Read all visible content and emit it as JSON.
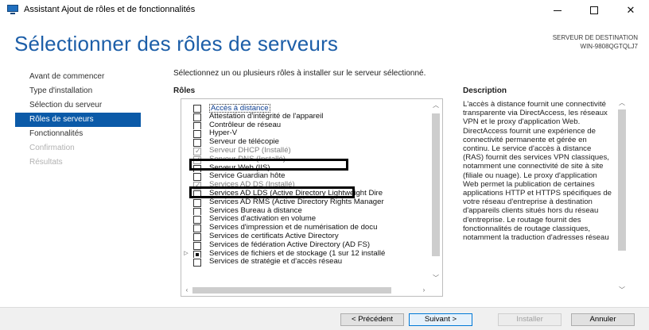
{
  "window": {
    "title": "Assistant Ajout de rôles et de fonctionnalités",
    "minimize_label": "—",
    "maximize_label": "☐",
    "close_label": "✕",
    "icon": "server-manager-icon"
  },
  "header": {
    "title": "Sélectionner des rôles de serveurs",
    "destination_label": "SERVEUR DE DESTINATION",
    "destination_server": "WIN-9808QGTQLJ7"
  },
  "nav": {
    "items": [
      {
        "label": "Avant de commencer",
        "state": "normal"
      },
      {
        "label": "Type d'installation",
        "state": "normal"
      },
      {
        "label": "Sélection du serveur",
        "state": "normal"
      },
      {
        "label": "Rôles de serveurs",
        "state": "active"
      },
      {
        "label": "Fonctionnalités",
        "state": "normal"
      },
      {
        "label": "Confirmation",
        "state": "disabled"
      },
      {
        "label": "Résultats",
        "state": "disabled"
      }
    ]
  },
  "main": {
    "intro": "Sélectionnez un ou plusieurs rôles à installer sur le serveur sélectionné.",
    "roles_heading": "Rôles",
    "description_heading": "Description",
    "roles": [
      {
        "label": "Accès à distance",
        "checked": false,
        "installed": false,
        "selected": true,
        "expander": ""
      },
      {
        "label": "Attestation d'intégrité de l'appareil",
        "checked": false,
        "installed": false,
        "selected": false,
        "expander": ""
      },
      {
        "label": "Contrôleur de réseau",
        "checked": false,
        "installed": false,
        "selected": false,
        "expander": ""
      },
      {
        "label": "Hyper-V",
        "checked": false,
        "installed": false,
        "selected": false,
        "expander": ""
      },
      {
        "label": "Serveur de télécopie",
        "checked": false,
        "installed": false,
        "selected": false,
        "expander": ""
      },
      {
        "label": "Serveur DHCP (Installé)",
        "checked": true,
        "installed": true,
        "selected": false,
        "expander": ""
      },
      {
        "label": "Serveur DNS (Installé)",
        "checked": true,
        "installed": true,
        "selected": false,
        "expander": ""
      },
      {
        "label": "Serveur Web (IIS)",
        "checked": false,
        "installed": false,
        "selected": false,
        "expander": ""
      },
      {
        "label": "Service Guardian hôte",
        "checked": false,
        "installed": false,
        "selected": false,
        "expander": ""
      },
      {
        "label": "Services AD DS (Installé)",
        "checked": true,
        "installed": true,
        "selected": false,
        "expander": ""
      },
      {
        "label": "Services AD LDS (Active Directory Lightweight Dire",
        "checked": false,
        "installed": false,
        "selected": false,
        "expander": ""
      },
      {
        "label": "Services AD RMS (Active Directory Rights Manager",
        "checked": false,
        "installed": false,
        "selected": false,
        "expander": ""
      },
      {
        "label": "Services Bureau à distance",
        "checked": false,
        "installed": false,
        "selected": false,
        "expander": ""
      },
      {
        "label": "Services d'activation en volume",
        "checked": false,
        "installed": false,
        "selected": false,
        "expander": ""
      },
      {
        "label": "Services d'impression et de numérisation de docu",
        "checked": false,
        "installed": false,
        "selected": false,
        "expander": ""
      },
      {
        "label": "Services de certificats Active Directory",
        "checked": false,
        "installed": false,
        "selected": false,
        "expander": ""
      },
      {
        "label": "Services de fédération Active Directory (AD FS)",
        "checked": false,
        "installed": false,
        "selected": false,
        "expander": ""
      },
      {
        "label": "Services de fichiers et de stockage (1 sur 12 installé",
        "checked": "partial",
        "installed": false,
        "selected": false,
        "expander": "▷"
      },
      {
        "label": "Services de stratégie et d'accès réseau",
        "checked": false,
        "installed": false,
        "selected": false,
        "expander": ""
      }
    ],
    "description": "L'accès à distance fournit une connectivité transparente via DirectAccess, les réseaux VPN et le proxy d'application Web. DirectAccess fournit une expérience de connectivité permanente et gérée en continu. Le service d'accès à distance (RAS) fournit des services VPN classiques, notamment une connectivité de site à site (filiale ou nuage). Le proxy d'application Web permet la publication de certaines applications HTTP et HTTPS spécifiques de votre réseau d'entreprise à destination d'appareils clients situés hors du réseau d'entreprise. Le routage fournit des fonctionnalités de routage classiques, notamment la traduction d'adresses réseau"
  },
  "footer": {
    "prev_label": "< Précédent",
    "next_label": "Suivant >",
    "install_label": "Installer",
    "cancel_label": "Annuler"
  }
}
